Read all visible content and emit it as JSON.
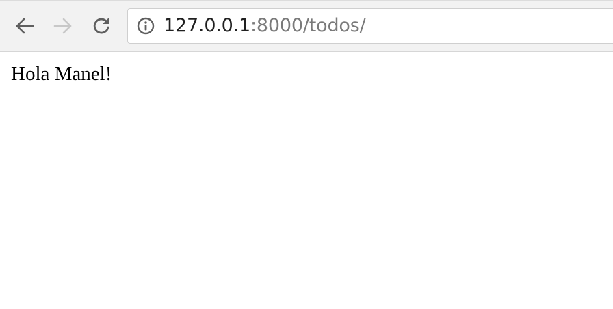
{
  "browser": {
    "nav": {
      "back_icon": "arrow-left-icon",
      "forward_icon": "arrow-right-icon",
      "reload_icon": "reload-icon"
    },
    "address_bar": {
      "security_icon": "info-circle-icon",
      "url_host": "127.0.0.1",
      "url_rest": ":8000/todos/"
    }
  },
  "page": {
    "greeting": "Hola Manel!"
  }
}
